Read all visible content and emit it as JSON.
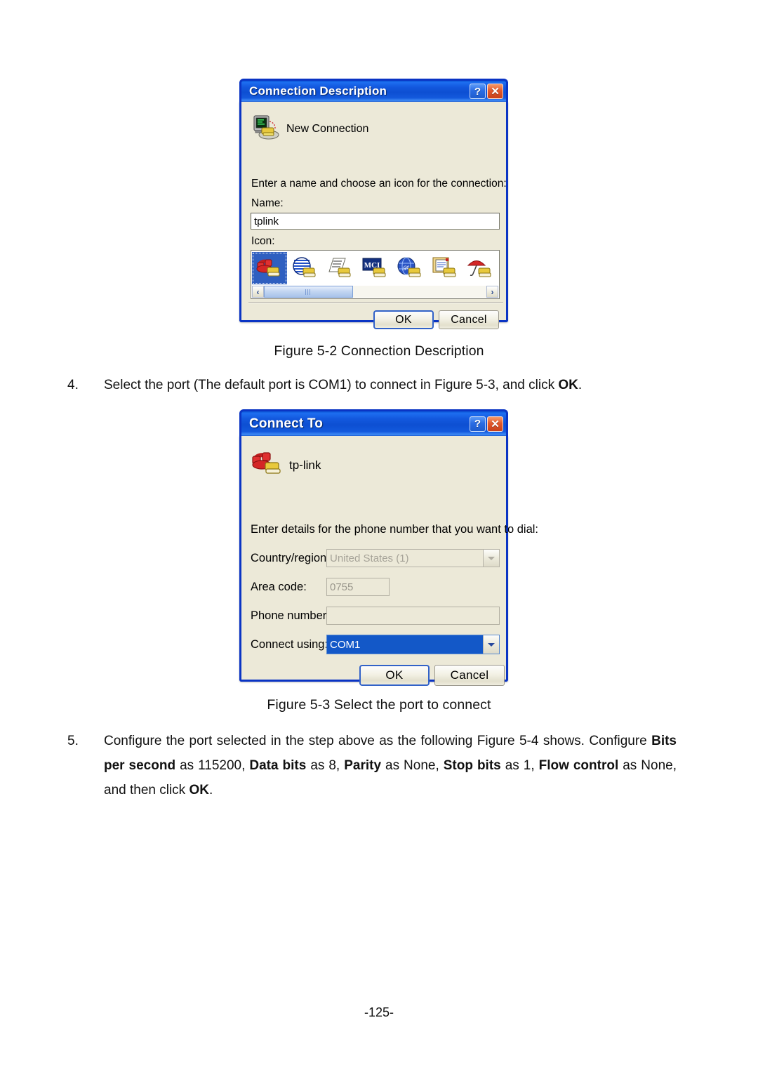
{
  "page": {
    "footer": "-125-"
  },
  "dialog_connection_description": {
    "title": "Connection Description",
    "titlebar_buttons": {
      "help": "?",
      "close": "✕"
    },
    "header_icon_name": "new-connection-icon",
    "header_label": "New Connection",
    "instruction": "Enter a name and choose an icon for the connection:",
    "name_label": "Name:",
    "name_value": "tplink",
    "icon_label": "Icon:",
    "icons": [
      {
        "name": "red-telephone-icon",
        "selected": true
      },
      {
        "name": "blue-globe-icon",
        "selected": false
      },
      {
        "name": "fax-paper-icon",
        "selected": false
      },
      {
        "name": "mci-logo-icon",
        "selected": false
      },
      {
        "name": "blue-ge-globe-icon",
        "selected": false
      },
      {
        "name": "documents-icon",
        "selected": false
      },
      {
        "name": "red-umbrella-icon",
        "selected": false
      }
    ],
    "scrollbar": {
      "left_arrow": "‹",
      "right_arrow": "›",
      "thumb_pct": 40
    },
    "ok_label": "OK",
    "cancel_label": "Cancel"
  },
  "caption_figure_5_2": "Figure 5-2 Connection Description",
  "step_4": {
    "number": "4.",
    "text_before": "Select the port (The default port is COM1) to connect in Figure 5-3, and click ",
    "bold": "OK",
    "text_after": "."
  },
  "dialog_connect_to": {
    "title": "Connect To",
    "titlebar_buttons": {
      "help": "?",
      "close": "✕"
    },
    "header_icon_name": "red-telephone-icon",
    "header_label": "tp-link",
    "instruction": "Enter details for the phone number that you want to dial:",
    "fields": [
      {
        "label": "Country/region:",
        "value": "United States (1)",
        "type": "combo",
        "disabled": true
      },
      {
        "label": "Area code:",
        "value": "0755",
        "type": "input",
        "disabled": true
      },
      {
        "label": "Phone number:",
        "value": "",
        "type": "input",
        "disabled": false
      },
      {
        "label": "Connect using:",
        "value": "COM1",
        "type": "combo",
        "disabled": false
      }
    ],
    "ok_label": "OK",
    "cancel_label": "Cancel"
  },
  "caption_figure_5_3": "Figure 5-3 Select the port to connect",
  "step_5": {
    "number": "5.",
    "seg1": "Configure the port selected in the step above as the following Figure 5-4 shows. Configure ",
    "b1": "Bits per second",
    "seg2": " as 115200, ",
    "b2": "Data bits",
    "seg3": " as 8, ",
    "b3": "Parity",
    "seg4": " as None, ",
    "b4": "Stop bits",
    "seg5": " as 1, ",
    "b5": "Flow control",
    "seg6": " as None, and then click ",
    "b6": "OK",
    "seg7": "."
  },
  "colors": {
    "title_blue": "#1358de",
    "border_blue": "#0A34C4",
    "dialog_face": "#ece9d8",
    "selection_blue": "#1358c8"
  }
}
